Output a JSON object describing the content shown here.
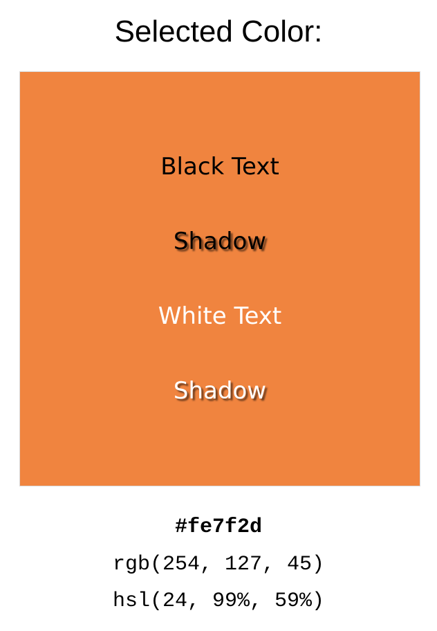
{
  "title": "Selected Color:",
  "swatch": {
    "color": "#f0843f",
    "black_text": "Black Text",
    "black_shadow": "Shadow",
    "white_text": "White Text",
    "white_shadow": "Shadow"
  },
  "codes": {
    "hex": "#fe7f2d",
    "rgb": "rgb(254, 127, 45)",
    "hsl": "hsl(24, 99%, 59%)"
  }
}
